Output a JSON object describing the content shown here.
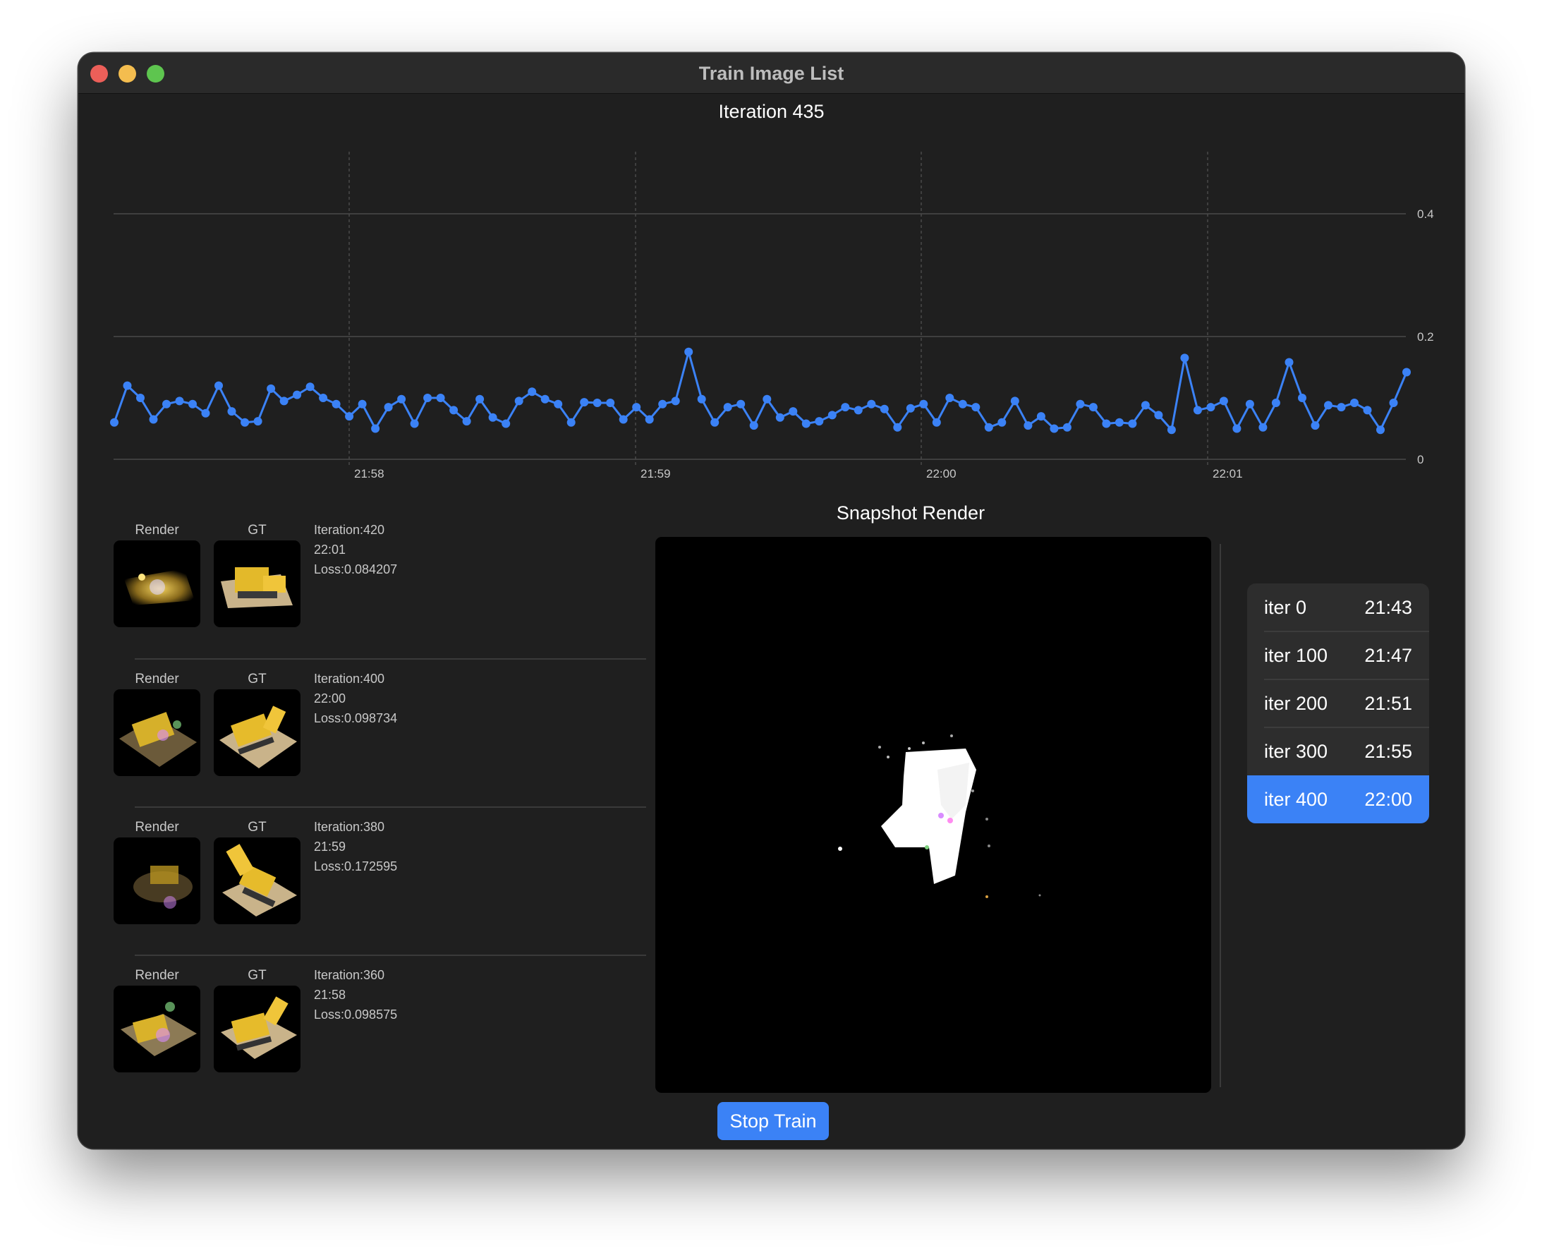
{
  "window": {
    "title": "Train Image List"
  },
  "chart_title": "Iteration 435",
  "chart_data": {
    "type": "line",
    "title": "Iteration 435",
    "xlabel": "",
    "ylabel": "",
    "x_ticks": [
      "21:58",
      "21:59",
      "22:00",
      "22:01"
    ],
    "y_ticks": [
      "0",
      "0.2",
      "0.4"
    ],
    "ylim": [
      0,
      0.5
    ],
    "grid": true,
    "color": "#3b82f6",
    "series": [
      {
        "values": [
          0.06,
          0.12,
          0.1,
          0.065,
          0.09,
          0.095,
          0.09,
          0.075,
          0.12,
          0.078,
          0.06,
          0.062,
          0.115,
          0.095,
          0.105,
          0.118,
          0.1,
          0.09,
          0.07,
          0.09,
          0.05,
          0.085,
          0.098,
          0.058,
          0.1,
          0.1,
          0.08,
          0.062,
          0.098,
          0.068,
          0.058,
          0.095,
          0.11,
          0.098,
          0.09,
          0.06,
          0.093,
          0.092,
          0.092,
          0.065,
          0.085,
          0.065,
          0.09,
          0.095,
          0.175,
          0.098,
          0.06,
          0.085,
          0.09,
          0.055,
          0.098,
          0.068,
          0.078,
          0.058,
          0.062,
          0.072,
          0.085,
          0.08,
          0.09,
          0.082,
          0.052,
          0.083,
          0.09,
          0.06,
          0.1,
          0.09,
          0.085,
          0.052,
          0.06,
          0.095,
          0.055,
          0.07,
          0.05,
          0.052,
          0.09,
          0.085,
          0.058,
          0.06,
          0.058,
          0.088,
          0.072,
          0.048,
          0.165,
          0.08,
          0.085,
          0.095,
          0.05,
          0.09,
          0.052,
          0.092,
          0.158,
          0.1,
          0.055,
          0.088,
          0.085,
          0.092,
          0.08,
          0.048,
          0.092,
          0.142
        ]
      }
    ]
  },
  "thumbnails": [
    {
      "render_label": "Render",
      "gt_label": "GT",
      "iteration": "Iteration:420",
      "time": "22:01",
      "loss": "Loss:0.084207"
    },
    {
      "render_label": "Render",
      "gt_label": "GT",
      "iteration": "Iteration:400",
      "time": "22:00",
      "loss": "Loss:0.098734"
    },
    {
      "render_label": "Render",
      "gt_label": "GT",
      "iteration": "Iteration:380",
      "time": "21:59",
      "loss": "Loss:0.172595"
    },
    {
      "render_label": "Render",
      "gt_label": "GT",
      "iteration": "Iteration:360",
      "time": "21:58",
      "loss": "Loss:0.098575"
    }
  ],
  "snapshot": {
    "title": "Snapshot Render",
    "items": [
      {
        "label": "iter 0",
        "time": "21:43"
      },
      {
        "label": "iter 100",
        "time": "21:47"
      },
      {
        "label": "iter 200",
        "time": "21:51"
      },
      {
        "label": "iter 300",
        "time": "21:55"
      },
      {
        "label": "iter 400",
        "time": "22:00"
      }
    ],
    "selected_label": "iter 400"
  },
  "stop_button": "Stop Train"
}
